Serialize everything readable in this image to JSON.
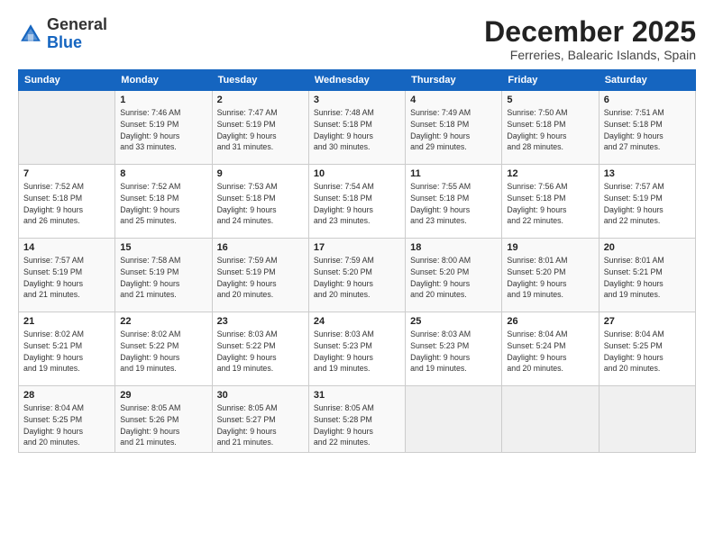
{
  "header": {
    "logo_general": "General",
    "logo_blue": "Blue",
    "month_title": "December 2025",
    "location": "Ferreries, Balearic Islands, Spain"
  },
  "weekdays": [
    "Sunday",
    "Monday",
    "Tuesday",
    "Wednesday",
    "Thursday",
    "Friday",
    "Saturday"
  ],
  "weeks": [
    [
      {
        "day": "",
        "info": ""
      },
      {
        "day": "1",
        "info": "Sunrise: 7:46 AM\nSunset: 5:19 PM\nDaylight: 9 hours\nand 33 minutes."
      },
      {
        "day": "2",
        "info": "Sunrise: 7:47 AM\nSunset: 5:19 PM\nDaylight: 9 hours\nand 31 minutes."
      },
      {
        "day": "3",
        "info": "Sunrise: 7:48 AM\nSunset: 5:18 PM\nDaylight: 9 hours\nand 30 minutes."
      },
      {
        "day": "4",
        "info": "Sunrise: 7:49 AM\nSunset: 5:18 PM\nDaylight: 9 hours\nand 29 minutes."
      },
      {
        "day": "5",
        "info": "Sunrise: 7:50 AM\nSunset: 5:18 PM\nDaylight: 9 hours\nand 28 minutes."
      },
      {
        "day": "6",
        "info": "Sunrise: 7:51 AM\nSunset: 5:18 PM\nDaylight: 9 hours\nand 27 minutes."
      }
    ],
    [
      {
        "day": "7",
        "info": "Sunrise: 7:52 AM\nSunset: 5:18 PM\nDaylight: 9 hours\nand 26 minutes."
      },
      {
        "day": "8",
        "info": "Sunrise: 7:52 AM\nSunset: 5:18 PM\nDaylight: 9 hours\nand 25 minutes."
      },
      {
        "day": "9",
        "info": "Sunrise: 7:53 AM\nSunset: 5:18 PM\nDaylight: 9 hours\nand 24 minutes."
      },
      {
        "day": "10",
        "info": "Sunrise: 7:54 AM\nSunset: 5:18 PM\nDaylight: 9 hours\nand 23 minutes."
      },
      {
        "day": "11",
        "info": "Sunrise: 7:55 AM\nSunset: 5:18 PM\nDaylight: 9 hours\nand 23 minutes."
      },
      {
        "day": "12",
        "info": "Sunrise: 7:56 AM\nSunset: 5:18 PM\nDaylight: 9 hours\nand 22 minutes."
      },
      {
        "day": "13",
        "info": "Sunrise: 7:57 AM\nSunset: 5:19 PM\nDaylight: 9 hours\nand 22 minutes."
      }
    ],
    [
      {
        "day": "14",
        "info": "Sunrise: 7:57 AM\nSunset: 5:19 PM\nDaylight: 9 hours\nand 21 minutes."
      },
      {
        "day": "15",
        "info": "Sunrise: 7:58 AM\nSunset: 5:19 PM\nDaylight: 9 hours\nand 21 minutes."
      },
      {
        "day": "16",
        "info": "Sunrise: 7:59 AM\nSunset: 5:19 PM\nDaylight: 9 hours\nand 20 minutes."
      },
      {
        "day": "17",
        "info": "Sunrise: 7:59 AM\nSunset: 5:20 PM\nDaylight: 9 hours\nand 20 minutes."
      },
      {
        "day": "18",
        "info": "Sunrise: 8:00 AM\nSunset: 5:20 PM\nDaylight: 9 hours\nand 20 minutes."
      },
      {
        "day": "19",
        "info": "Sunrise: 8:01 AM\nSunset: 5:20 PM\nDaylight: 9 hours\nand 19 minutes."
      },
      {
        "day": "20",
        "info": "Sunrise: 8:01 AM\nSunset: 5:21 PM\nDaylight: 9 hours\nand 19 minutes."
      }
    ],
    [
      {
        "day": "21",
        "info": "Sunrise: 8:02 AM\nSunset: 5:21 PM\nDaylight: 9 hours\nand 19 minutes."
      },
      {
        "day": "22",
        "info": "Sunrise: 8:02 AM\nSunset: 5:22 PM\nDaylight: 9 hours\nand 19 minutes."
      },
      {
        "day": "23",
        "info": "Sunrise: 8:03 AM\nSunset: 5:22 PM\nDaylight: 9 hours\nand 19 minutes."
      },
      {
        "day": "24",
        "info": "Sunrise: 8:03 AM\nSunset: 5:23 PM\nDaylight: 9 hours\nand 19 minutes."
      },
      {
        "day": "25",
        "info": "Sunrise: 8:03 AM\nSunset: 5:23 PM\nDaylight: 9 hours\nand 19 minutes."
      },
      {
        "day": "26",
        "info": "Sunrise: 8:04 AM\nSunset: 5:24 PM\nDaylight: 9 hours\nand 20 minutes."
      },
      {
        "day": "27",
        "info": "Sunrise: 8:04 AM\nSunset: 5:25 PM\nDaylight: 9 hours\nand 20 minutes."
      }
    ],
    [
      {
        "day": "28",
        "info": "Sunrise: 8:04 AM\nSunset: 5:25 PM\nDaylight: 9 hours\nand 20 minutes."
      },
      {
        "day": "29",
        "info": "Sunrise: 8:05 AM\nSunset: 5:26 PM\nDaylight: 9 hours\nand 21 minutes."
      },
      {
        "day": "30",
        "info": "Sunrise: 8:05 AM\nSunset: 5:27 PM\nDaylight: 9 hours\nand 21 minutes."
      },
      {
        "day": "31",
        "info": "Sunrise: 8:05 AM\nSunset: 5:28 PM\nDaylight: 9 hours\nand 22 minutes."
      },
      {
        "day": "",
        "info": ""
      },
      {
        "day": "",
        "info": ""
      },
      {
        "day": "",
        "info": ""
      }
    ]
  ]
}
